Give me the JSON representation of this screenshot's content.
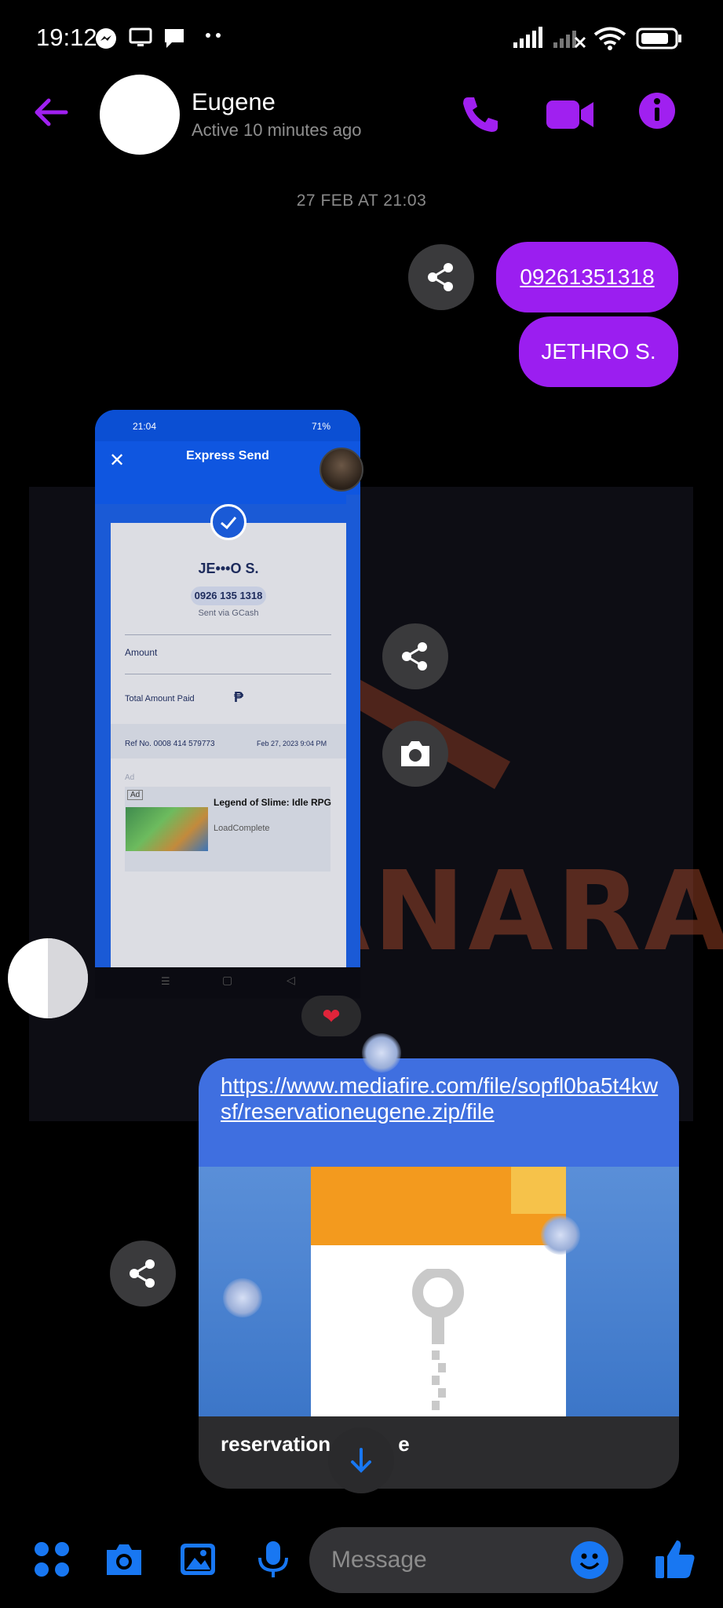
{
  "status_bar": {
    "time": "19:12",
    "battery": "72"
  },
  "header": {
    "contact_name": "Eugene",
    "contact_status": "Active 10 minutes ago"
  },
  "conversation": {
    "date_separator": "27 FEB AT 21:03",
    "messages": [
      {
        "text": "09261351318"
      },
      {
        "text": "JETHRO S."
      }
    ],
    "screenshot": {
      "status_time": "21:04",
      "status_battery": "71%",
      "title": "Express Send",
      "recipient": "JE•••O S.",
      "phone": "0926 135 1318",
      "via": "Sent via GCash",
      "amount_label": "Amount",
      "total_label": "Total Amount Paid",
      "currency_symbol": "₱",
      "ref_label": "Ref No. 0008 414 579773",
      "ref_date": "Feb 27, 2023 9:04 PM",
      "ad_label": "Ad",
      "ad_tag": "Ad",
      "ad_title": "Legend of Slime: Idle RPG",
      "ad_sub": "LoadComplete"
    },
    "watermark": "SANARA",
    "reaction": "❤",
    "link": {
      "url": "https://www.mediafire.com/file/sopfl0ba5t4kwsf/reservationeugene.zip/file",
      "caption": "reservation",
      "caption_tail": "e"
    }
  },
  "composer": {
    "placeholder": "Message"
  },
  "colors": {
    "accent": "#9b1ef0",
    "blue": "#1877f2"
  }
}
